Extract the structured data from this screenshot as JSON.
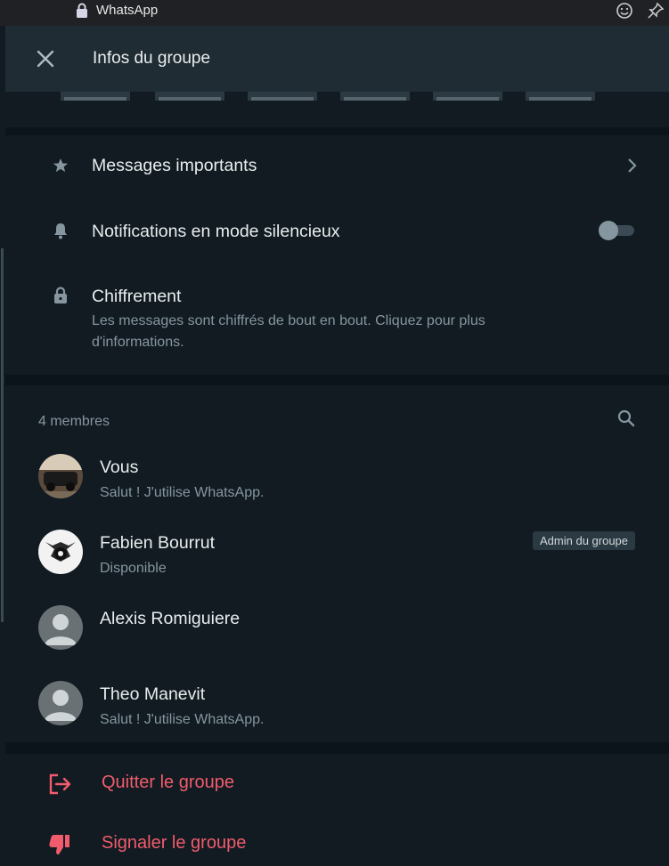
{
  "titlebar": {
    "app_name": "WhatsApp",
    "icons": [
      "lock-icon",
      "emoji-icon",
      "pin-icon"
    ]
  },
  "header": {
    "title": "Infos du groupe",
    "close_icon": "close-icon"
  },
  "options": {
    "starred": {
      "label": "Messages importants",
      "icon": "star-icon"
    },
    "mute": {
      "label": "Notifications en mode silencieux",
      "icon": "bell-icon",
      "enabled": false
    },
    "encryption": {
      "label": "Chiffrement",
      "description_line1": "Les messages sont chiffrés de bout en bout. Cliquez pour plus",
      "description_line2": "d'informations.",
      "icon": "lock-icon"
    }
  },
  "members": {
    "count_label": "4 membres",
    "search_icon": "search-icon",
    "list": [
      {
        "name": "Vous",
        "status": "Salut ! J'utilise WhatsApp.",
        "admin": false
      },
      {
        "name": "Fabien Bourrut",
        "status": "Disponible",
        "admin": true,
        "admin_label": "Admin du groupe"
      },
      {
        "name": "Alexis  Romiguiere",
        "status": "",
        "admin": false
      },
      {
        "name": "Theo Manevit",
        "status": "Salut ! J'utilise WhatsApp.",
        "admin": false
      }
    ]
  },
  "actions": {
    "leave": {
      "label": "Quitter le groupe",
      "icon": "exit-icon"
    },
    "report": {
      "label": "Signaler le groupe",
      "icon": "thumbs-down-icon"
    }
  },
  "colors": {
    "background": "#0b141a",
    "panel": "#111b21",
    "header": "#202c33",
    "primary_text": "#e9edef",
    "secondary_text": "#8696a0",
    "danger": "#f15c6d"
  }
}
